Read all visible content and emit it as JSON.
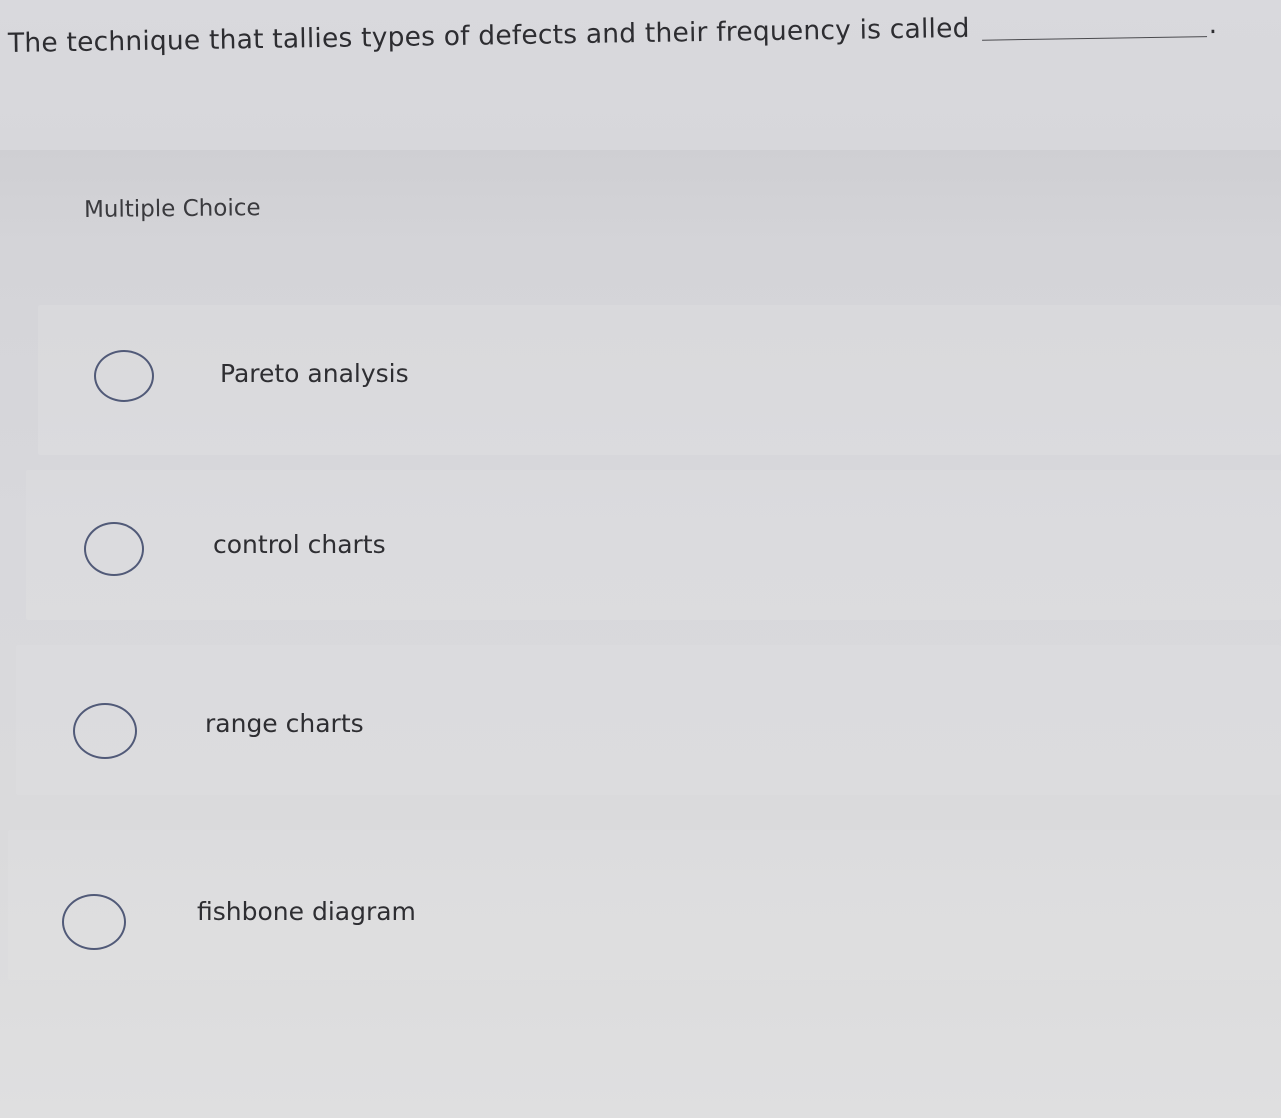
{
  "question": {
    "text": "The technique that tallies types of defects and their frequency is called",
    "period": "."
  },
  "section_label": "Multiple Choice",
  "choices": [
    {
      "label": "Pareto analysis",
      "selected": false
    },
    {
      "label": "control charts",
      "selected": false
    },
    {
      "label": "range charts",
      "selected": false
    },
    {
      "label": "fishbone diagram",
      "selected": false
    }
  ],
  "colors": {
    "background": "#d8d8dc",
    "text": "#2f2f33",
    "radio_border": "#515a78"
  }
}
